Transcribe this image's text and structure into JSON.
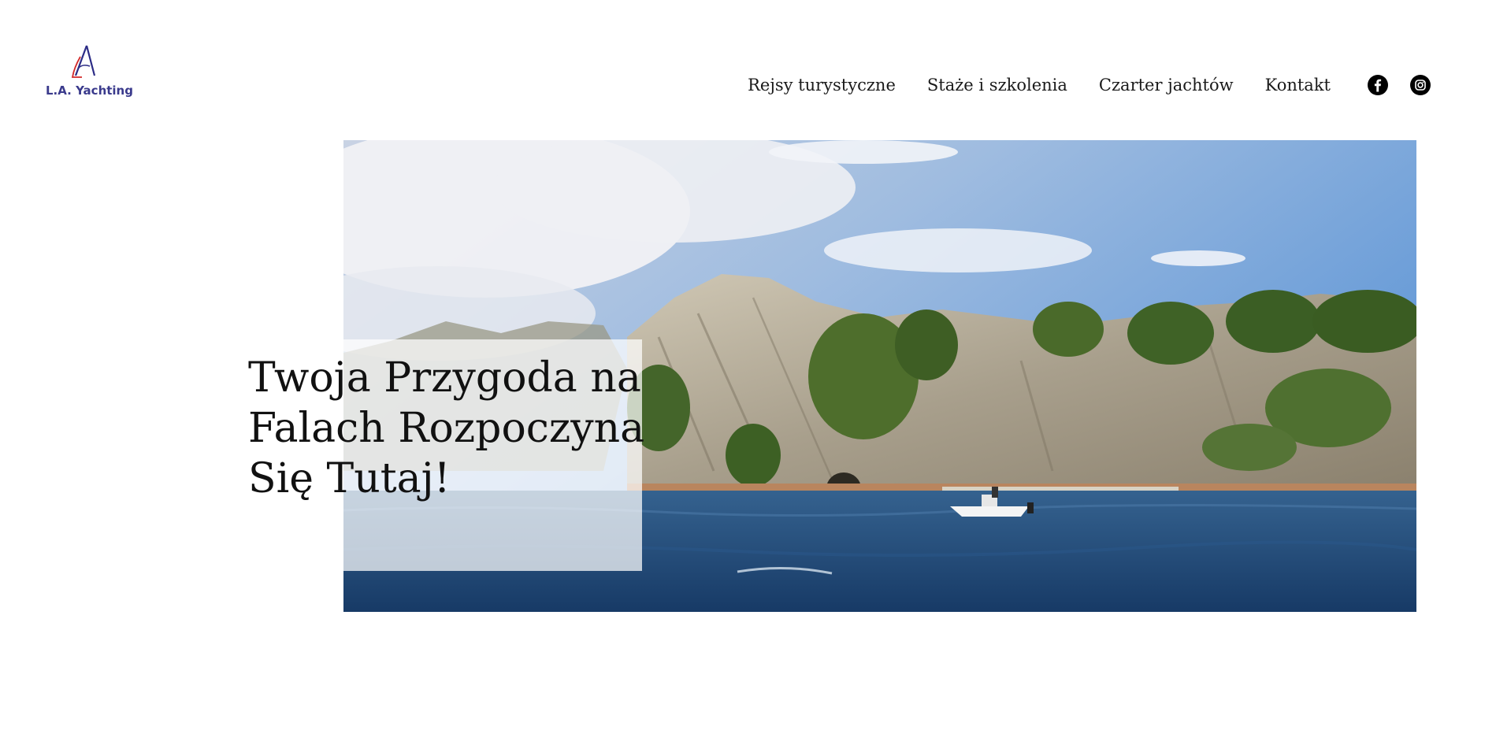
{
  "header": {
    "logo_text": "L.A. Yachting",
    "nav": [
      {
        "label": "Rejsy turystyczne"
      },
      {
        "label": "Staże i szkolenia"
      },
      {
        "label": "Czarter jachtów"
      },
      {
        "label": "Kontakt"
      }
    ],
    "social": [
      {
        "icon": "facebook-icon"
      },
      {
        "icon": "instagram-icon"
      }
    ]
  },
  "hero": {
    "headline": "Twoja Przygoda na Falach Rozpoczyna Się Tutaj!",
    "image_icon": "coastline-photo"
  },
  "colors": {
    "logo_text": "#3a3a8c",
    "logo_blue": "#2c2c86",
    "logo_red": "#d22a2a",
    "text": "#111111"
  }
}
